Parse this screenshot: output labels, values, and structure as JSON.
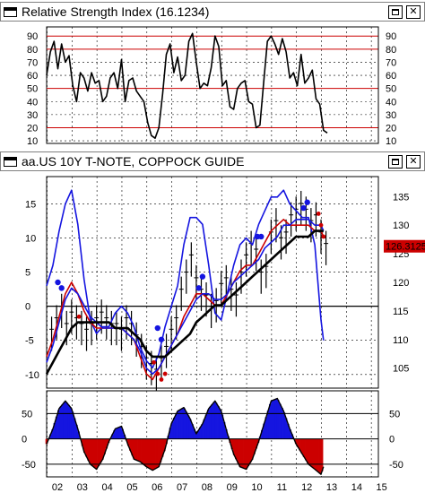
{
  "rsi_panel": {
    "title": "Relative Strength Index (16.1234)"
  },
  "main_panel": {
    "title": "aa.US 10Y T-NOTE, COPPOCK GUIDE",
    "price_tag": "126.3125"
  },
  "colors": {
    "black": "#000000",
    "red": "#cc0000",
    "blue": "#1515e0",
    "gridline": "#000000",
    "tagbg": "#cc0000"
  },
  "chart_data": [
    {
      "type": "line",
      "title": "Relative Strength Index (16.1234)",
      "yticks": [
        10,
        20,
        30,
        40,
        50,
        60,
        70,
        80,
        90
      ],
      "ylim": [
        8,
        97
      ],
      "reference_lines": [
        20,
        50,
        80,
        90
      ],
      "x": [
        2.0,
        2.15,
        2.3,
        2.45,
        2.6,
        2.75,
        2.9,
        3.05,
        3.2,
        3.35,
        3.5,
        3.65,
        3.8,
        3.95,
        4.1,
        4.25,
        4.4,
        4.55,
        4.7,
        4.85,
        5.0,
        5.15,
        5.3,
        5.45,
        5.6,
        5.75,
        5.9,
        6.05,
        6.2,
        6.35,
        6.5,
        6.65,
        6.8,
        6.95,
        7.1,
        7.25,
        7.4,
        7.55,
        7.7,
        7.85,
        8.0,
        8.15,
        8.3,
        8.45,
        8.6,
        8.75,
        8.9,
        9.05,
        9.2,
        9.35,
        9.5,
        9.65,
        9.8,
        9.95,
        10.1,
        10.25,
        10.4,
        10.55,
        10.7,
        10.85,
        11.0,
        11.15,
        11.3,
        11.45,
        11.6,
        11.75,
        11.9,
        12.05,
        12.2,
        12.35,
        12.5,
        12.65,
        12.8,
        12.95,
        13.1,
        13.25
      ],
      "values": [
        60,
        78,
        86,
        65,
        84,
        70,
        75,
        52,
        40,
        62,
        58,
        48,
        62,
        54,
        56,
        40,
        44,
        58,
        62,
        50,
        72,
        40,
        56,
        58,
        48,
        44,
        40,
        24,
        14,
        12,
        20,
        46,
        76,
        84,
        62,
        74,
        56,
        60,
        86,
        92,
        70,
        50,
        54,
        52,
        66,
        90,
        82,
        52,
        56,
        36,
        34,
        50,
        54,
        56,
        40,
        38,
        20,
        22,
        54,
        86,
        90,
        84,
        76,
        88,
        78,
        58,
        62,
        52,
        76,
        54,
        58,
        64,
        42,
        38,
        18,
        16
      ],
      "series": [
        {
          "name": "",
          "color": "#000000"
        }
      ]
    },
    {
      "type": "line",
      "title": "aa.US 10Y T-NOTE, COPPOCK GUIDE",
      "left_yticks": [
        -10,
        -5,
        0,
        5,
        10,
        15
      ],
      "left_ylim": [
        -12,
        19
      ],
      "right_yticks": [
        105,
        110,
        115,
        120,
        125,
        130,
        135
      ],
      "right_ylim": [
        101.5,
        138.5
      ],
      "x": [
        2.0,
        2.25,
        2.5,
        2.75,
        3.0,
        3.25,
        3.5,
        3.75,
        4.0,
        4.25,
        4.5,
        4.75,
        5.0,
        5.25,
        5.5,
        5.75,
        6.0,
        6.25,
        6.5,
        6.75,
        7.0,
        7.25,
        7.5,
        7.75,
        8.0,
        8.25,
        8.5,
        8.75,
        9.0,
        9.25,
        9.5,
        9.75,
        10.0,
        10.25,
        10.5,
        10.75,
        11.0,
        11.25,
        11.5,
        11.75,
        12.0,
        12.25,
        12.5,
        12.75,
        13.0,
        13.1
      ],
      "price_tag": "126.3125",
      "series": [
        {
          "name": "",
          "color": "#1515e0",
          "axis": "left",
          "values": [
            3,
            6,
            11,
            15,
            17,
            12,
            4,
            -2,
            -4,
            -3,
            -3,
            -1,
            0,
            -1,
            -3,
            -6,
            -8,
            -9,
            -7,
            -3,
            0,
            3,
            9,
            13,
            13,
            12,
            6,
            -1,
            -2,
            2,
            6,
            9,
            10,
            9,
            12,
            14,
            16,
            16,
            17,
            15,
            14,
            13,
            13,
            9,
            -2,
            -5
          ]
        },
        {
          "name": "",
          "color": "#cc0000",
          "axis": "right",
          "values": [
            107,
            110,
            114,
            118,
            120,
            118,
            115,
            113,
            112,
            112,
            112,
            112,
            112,
            111,
            110,
            107,
            104,
            103,
            105,
            107,
            109,
            111,
            114,
            116,
            118,
            118,
            117,
            116,
            116,
            118,
            120,
            122,
            123,
            123,
            125,
            127,
            129,
            130,
            131,
            130,
            130,
            130,
            130,
            129,
            129,
            128
          ]
        },
        {
          "name": "",
          "color": "#1515e0",
          "axis": "right",
          "values": [
            106,
            109,
            113,
            117,
            119,
            118,
            116,
            114,
            113,
            112,
            112,
            112,
            112,
            111,
            110,
            108,
            105,
            104,
            105,
            107,
            109,
            111,
            113,
            115,
            117,
            118,
            118,
            117,
            117,
            118,
            120,
            121,
            122,
            123,
            124,
            126,
            127,
            128,
            130,
            130,
            131,
            131,
            131,
            130,
            130,
            129
          ]
        },
        {
          "name": "",
          "color": "#000000",
          "axis": "right",
          "values": [
            104,
            106,
            108,
            110,
            112,
            113,
            113,
            113,
            113,
            113,
            113,
            112,
            112,
            112,
            111,
            110,
            108,
            107,
            107,
            107,
            108,
            109,
            110,
            111,
            113,
            114,
            115,
            116,
            116,
            117,
            118,
            119,
            120,
            121,
            122,
            123,
            124,
            125,
            126,
            127,
            128,
            128,
            128,
            129,
            129,
            129
          ]
        }
      ],
      "price_bars": {
        "x": [
          2.2,
          2.4,
          2.6,
          2.8,
          3.0,
          3.2,
          3.4,
          3.6,
          3.8,
          4.0,
          4.2,
          4.4,
          4.6,
          4.8,
          5.0,
          5.2,
          5.4,
          5.6,
          5.8,
          6.0,
          6.2,
          6.4,
          6.6,
          6.8,
          7.0,
          7.2,
          7.4,
          7.6,
          7.8,
          8.0,
          8.2,
          8.4,
          8.6,
          8.8,
          9.0,
          9.2,
          9.4,
          9.6,
          9.8,
          10.0,
          10.2,
          10.4,
          10.6,
          10.8,
          11.0,
          11.2,
          11.4,
          11.6,
          11.8,
          12.0,
          12.2,
          12.4,
          12.6,
          12.8,
          13.0,
          13.2
        ],
        "close": [
          111,
          113,
          115,
          112,
          114,
          113,
          112,
          111,
          112,
          113,
          114,
          113,
          112,
          112,
          111,
          113,
          112,
          110,
          108,
          106,
          105,
          104,
          106,
          108,
          111,
          113,
          118,
          121,
          124,
          120,
          118,
          117,
          115,
          116,
          119,
          120,
          118,
          117,
          121,
          124,
          126,
          125,
          121,
          122,
          128,
          130,
          127,
          128,
          131,
          132,
          133,
          132,
          130,
          131,
          128,
          126
        ]
      },
      "signal_dots": {
        "blue": [
          [
            2.45,
            120
          ],
          [
            2.6,
            119
          ],
          [
            6.45,
            112
          ],
          [
            6.6,
            110
          ],
          [
            8.1,
            119
          ],
          [
            8.25,
            121
          ],
          [
            10.45,
            128
          ],
          [
            10.6,
            128
          ],
          [
            12.3,
            133
          ],
          [
            12.45,
            134
          ]
        ],
        "red": [
          [
            3.3,
            114
          ],
          [
            6.3,
            106
          ],
          [
            6.45,
            104
          ],
          [
            6.6,
            103
          ],
          [
            6.75,
            104
          ],
          [
            12.9,
            132
          ],
          [
            13.0,
            130
          ],
          [
            13.1,
            128
          ]
        ]
      }
    },
    {
      "type": "bar",
      "title": "",
      "yticks": [
        -50,
        0,
        50
      ],
      "ylim": [
        -75,
        95
      ],
      "reference_lines": [
        -50,
        0,
        50
      ],
      "x_tick_labels": [
        "02",
        "03",
        "04",
        "05",
        "06",
        "07",
        "08",
        "09",
        "10",
        "11",
        "12",
        "13",
        "14",
        "15"
      ],
      "x": [
        2.0,
        2.25,
        2.5,
        2.75,
        3.0,
        3.25,
        3.5,
        3.75,
        4.0,
        4.25,
        4.5,
        4.75,
        5.0,
        5.25,
        5.5,
        5.75,
        6.0,
        6.25,
        6.5,
        6.75,
        7.0,
        7.25,
        7.5,
        7.75,
        8.0,
        8.25,
        8.5,
        8.75,
        9.0,
        9.25,
        9.5,
        9.75,
        10.0,
        10.25,
        10.5,
        10.75,
        11.0,
        11.25,
        11.5,
        11.75,
        12.0,
        12.25,
        12.5,
        12.75,
        13.0,
        13.1
      ],
      "values": [
        -10,
        20,
        60,
        75,
        60,
        20,
        -25,
        -50,
        -60,
        -40,
        -5,
        20,
        25,
        -10,
        -40,
        -45,
        -55,
        -62,
        -55,
        -20,
        30,
        55,
        62,
        40,
        10,
        30,
        60,
        75,
        55,
        10,
        -30,
        -55,
        -60,
        -40,
        -5,
        35,
        75,
        80,
        55,
        20,
        -10,
        -30,
        -50,
        -60,
        -70,
        -55
      ],
      "series": [
        {
          "name": "",
          "color_positive": "#1515e0",
          "color_negative": "#cc0000"
        }
      ]
    }
  ]
}
